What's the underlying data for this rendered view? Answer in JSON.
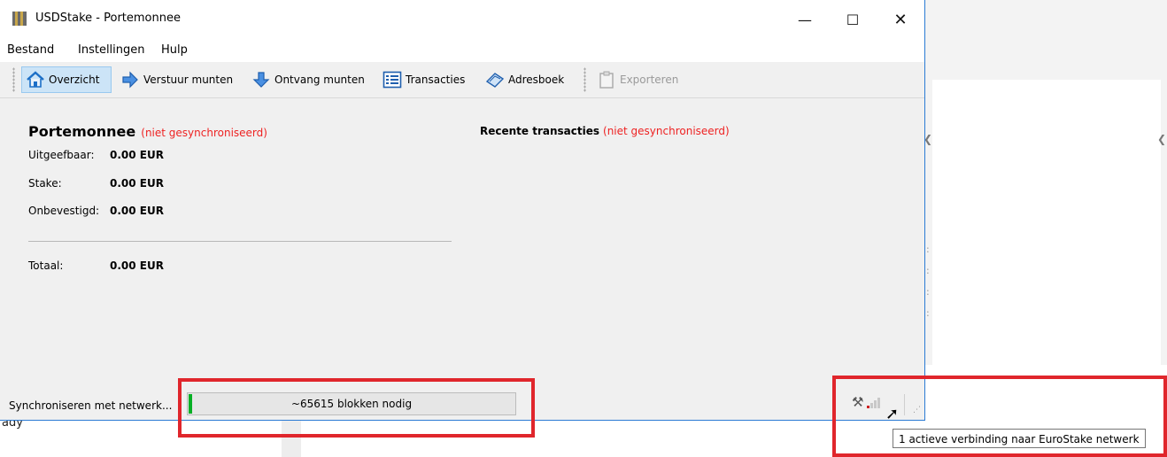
{
  "window": {
    "title": "USDStake - Portemonnee",
    "minimize_glyph": "—",
    "maximize_glyph": "☐",
    "close_glyph": "✕"
  },
  "menu": {
    "items": [
      "Bestand",
      "Instellingen",
      "Hulp"
    ]
  },
  "toolbar": {
    "overview": "Overzicht",
    "send": "Verstuur munten",
    "receive": "Ontvang munten",
    "transactions": "Transacties",
    "addressbook": "Adresboek",
    "export": "Exporteren"
  },
  "wallet": {
    "title": "Portemonnee",
    "not_synced": "(niet gesynchroniseerd)",
    "spendable_label": "Uitgeefbaar:",
    "spendable_value": "0.00 EUR",
    "stake_label": "Stake:",
    "stake_value": "0.00 EUR",
    "unconfirmed_label": "Onbevestigd:",
    "unconfirmed_value": "0.00 EUR",
    "total_label": "Totaal:",
    "total_value": "0.00 EUR"
  },
  "recent": {
    "title": "Recente transacties",
    "not_synced": "(niet gesynchroniseerd)"
  },
  "status": {
    "sync_label": "Synchroniseren met netwerk...",
    "progress_text": "~65615 blokken nodig",
    "progress_fraction": 0.01,
    "tooltip": "1 actieve verbinding naar EuroStake netwerk"
  },
  "background": {
    "partial_text": "ady"
  },
  "colors": {
    "not_synced": "#ee2222",
    "highlight": "#e0262c",
    "progress": "#06b025"
  }
}
